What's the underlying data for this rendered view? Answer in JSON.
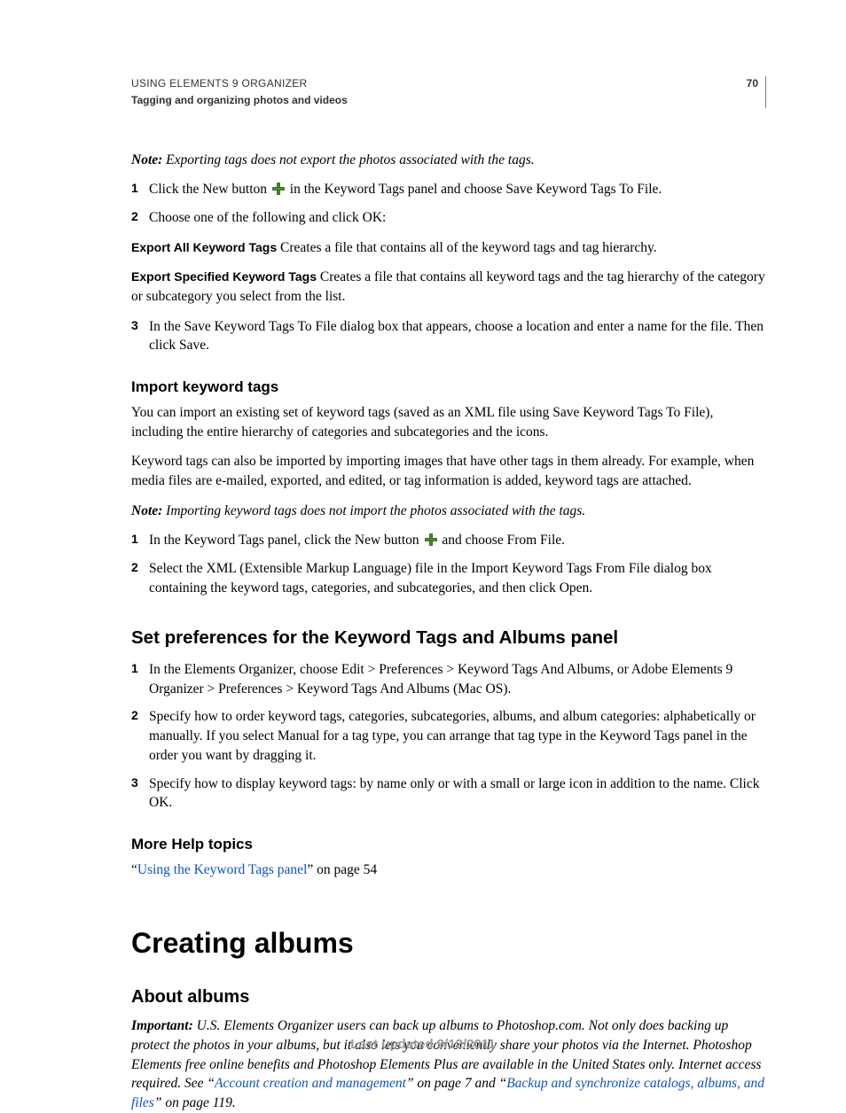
{
  "header": {
    "title": "USING ELEMENTS 9 ORGANIZER",
    "subtitle": "Tagging and organizing photos and videos",
    "pageNumber": "70"
  },
  "note1": {
    "label": "Note:",
    "text": " Exporting tags does not export the photos associated with the tags."
  },
  "list1": {
    "n1": "1",
    "t1a": "Click the New button ",
    "t1b": " in the Keyword Tags panel and choose Save Keyword Tags To File.",
    "n2": "2",
    "t2": "Choose one of the following and click OK:"
  },
  "def1": {
    "term": "Export All Keyword Tags",
    "body": "  Creates a file that contains all of the keyword tags and tag hierarchy."
  },
  "def2": {
    "term": "Export Specified Keyword Tags",
    "body": "  Creates a file that contains all keyword tags and the tag hierarchy of the category or subcategory you select from the list."
  },
  "list1b": {
    "n3": "3",
    "t3": "In the Save Keyword Tags To File dialog box that appears, choose a location and enter a name for the file. Then click Save."
  },
  "sec_import": {
    "heading": "Import keyword tags",
    "p1": "You can import an existing set of keyword tags (saved as an XML file using Save Keyword Tags To File), including the entire hierarchy of categories and subcategories and the icons.",
    "p2": "Keyword tags can also be imported by importing images that have other tags in them already. For example, when media files are e-mailed, exported, and edited, or tag information is added, keyword tags are attached."
  },
  "note2": {
    "label": "Note:",
    "text": " Importing keyword tags does not import the photos associated with the tags."
  },
  "list2": {
    "n1": "1",
    "t1a": "In the Keyword Tags panel, click the New button ",
    "t1b": " and choose From File.",
    "n2": "2",
    "t2": "Select the XML (Extensible Markup Language) file in the Import Keyword Tags From File dialog box containing the keyword tags, categories, and subcategories, and then click Open."
  },
  "sec_prefs": {
    "heading": "Set preferences for the Keyword Tags and Albums panel",
    "n1": "1",
    "t1": "In the Elements Organizer, choose Edit > Preferences > Keyword Tags And Albums, or Adobe Elements 9 Organizer > Preferences > Keyword Tags And Albums (Mac OS).",
    "n2": "2",
    "t2": "Specify how to order keyword tags, categories, subcategories, albums, and album categories: alphabetically or manually. If you select Manual for a tag type, you can arrange that tag type in the Keyword Tags panel in the order you want by dragging it.",
    "n3": "3",
    "t3": "Specify how to display keyword tags: by name only or with a small or large icon in addition to the name. Click OK."
  },
  "morehelp": {
    "heading": "More Help topics",
    "q1": "“",
    "link": "Using the Keyword Tags panel",
    "q2": "” on page 54"
  },
  "sec_albums": {
    "h1": "Creating albums",
    "h2": "About albums"
  },
  "important": {
    "label": "Important:",
    "t1": " U.S. Elements Organizer users can back up albums to Photoshop.com. Not only does backing up protect the photos in your albums, but it also lets you conveniently share your photos via the Internet. Photoshop Elements free online benefits and Photoshop Elements Plus are available in the United States only. Internet access required. See “",
    "l1": "Account creation and management",
    "t2": "” on page 7 and “",
    "l2": "Backup and synchronize catalogs, albums, and files",
    "t3": "” on page 119."
  },
  "footer": "Last updated 9/12/2011"
}
